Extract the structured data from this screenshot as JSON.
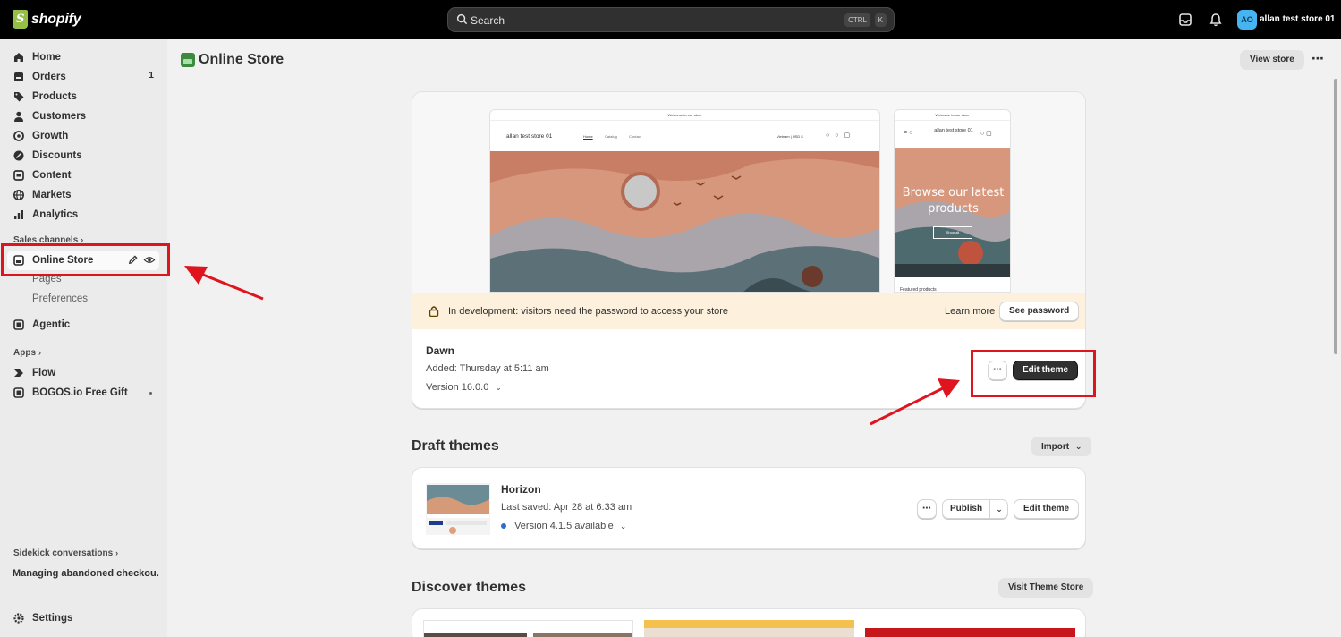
{
  "topbar": {
    "logo_text": "shopify",
    "search_placeholder": "Search",
    "shortcut_ctrl": "CTRL",
    "shortcut_k": "K",
    "avatar_initials": "AO",
    "store_name": "allan test store 01"
  },
  "sidebar": {
    "items": [
      {
        "label": "Home",
        "icon": "home-icon"
      },
      {
        "label": "Orders",
        "icon": "orders-icon",
        "count": "1"
      },
      {
        "label": "Products",
        "icon": "tag-icon"
      },
      {
        "label": "Customers",
        "icon": "person-icon"
      },
      {
        "label": "Growth",
        "icon": "growth-icon"
      },
      {
        "label": "Discounts",
        "icon": "discount-icon"
      },
      {
        "label": "Content",
        "icon": "content-icon"
      },
      {
        "label": "Markets",
        "icon": "globe-icon"
      },
      {
        "label": "Analytics",
        "icon": "chart-icon"
      }
    ],
    "sales_channels_label": "Sales channels",
    "online_store_label": "Online Store",
    "sub_items": [
      "Pages",
      "Preferences"
    ],
    "agentic_label": "Agentic",
    "apps_label": "Apps",
    "apps": [
      "Flow",
      "BOGOS.io Free Gift"
    ],
    "sidekick_label": "Sidekick conversations",
    "sidekick_item": "Managing abandoned checkou...",
    "settings_label": "Settings"
  },
  "main": {
    "title": "Online Store",
    "view_store": "View store",
    "current_theme": {
      "banner_text": "In development: visitors need the password to access your store",
      "learn_more": "Learn more",
      "see_password": "See password",
      "name": "Dawn",
      "added": "Added: Thursday at 5:11 am",
      "version": "Version 16.0.0",
      "edit_theme": "Edit theme",
      "preview": {
        "announcement": "Welcome to our store",
        "store_name": "allan test store 01",
        "nav": [
          "Home",
          "Catalog",
          "Contact"
        ],
        "currency": "Vietnam | USD $",
        "mobile_heading": "Browse our latest products",
        "shop_all": "Shop all",
        "featured": "Featured products"
      }
    },
    "draft": {
      "title": "Draft themes",
      "import": "Import",
      "theme_name": "Horizon",
      "saved": "Last saved: Apr 28 at 6:33 am",
      "version": "Version 4.1.5 available",
      "publish": "Publish",
      "edit_theme": "Edit theme"
    },
    "discover": {
      "title": "Discover themes",
      "visit": "Visit Theme Store"
    }
  },
  "colors": {
    "topbar": "#000000",
    "sidebar": "#ebebeb",
    "accent_green": "#95bf47",
    "annotation_red": "#e0141e",
    "banner": "#fdf0dd"
  }
}
